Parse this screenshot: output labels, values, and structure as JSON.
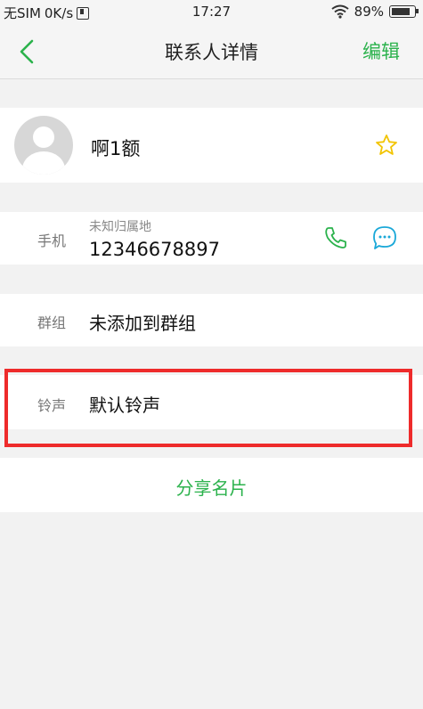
{
  "status_bar": {
    "carrier": "无SIM",
    "speed": "0K/s",
    "time": "17:27",
    "battery_percent": "89%",
    "battery_level": 0.89
  },
  "nav": {
    "title": "联系人详情",
    "edit_label": "编辑"
  },
  "contact": {
    "name": "啊1额"
  },
  "phone": {
    "label": "手机",
    "location": "未知归属地",
    "number": "12346678897"
  },
  "group": {
    "label": "群组",
    "value": "未添加到群组"
  },
  "ringtone": {
    "label": "铃声",
    "value": "默认铃声"
  },
  "share": {
    "label": "分享名片"
  },
  "colors": {
    "accent": "#2bb24c",
    "highlight": "#ee2b2b",
    "star": "#f2c400",
    "message": "#1aa8d8"
  }
}
